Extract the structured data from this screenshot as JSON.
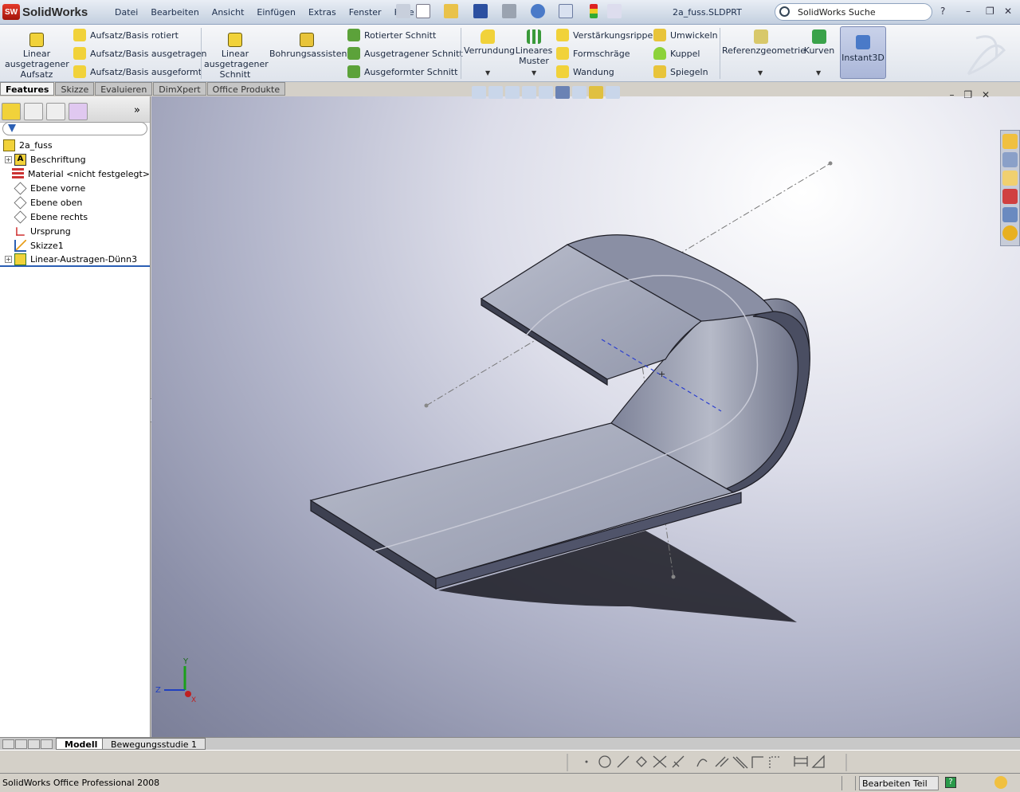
{
  "app": {
    "name": "SolidWorks",
    "logo_badge": "SW",
    "document_title": "2a_fuss.SLDPRT"
  },
  "menu": [
    "Datei",
    "Bearbeiten",
    "Ansicht",
    "Einfügen",
    "Extras",
    "Fenster",
    "Hilfe"
  ],
  "search": {
    "placeholder": "SolidWorks Suche"
  },
  "window_controls": {
    "help": "?",
    "minimize": "–",
    "restore": "❐",
    "close": "✕"
  },
  "command_manager": {
    "linear_boss": "Linear ausgetragener Aufsatz",
    "revolved_boss": "Aufsatz/Basis rotiert",
    "swept_boss": "Aufsatz/Basis ausgetragen",
    "lofted_boss": "Aufsatz/Basis ausgeformt",
    "extruded_cut": "Linear ausgetragener Schnitt",
    "hole_wizard": "Bohrungsassistent",
    "revolved_cut": "Rotierter Schnitt",
    "swept_cut": "Ausgetragener Schnitt",
    "lofted_cut": "Ausgeformter Schnitt",
    "fillet": "Verrundung",
    "linear_pattern": "Lineares Muster",
    "rib": "Verstärkungsrippe",
    "draft": "Formschräge",
    "shell": "Wandung",
    "wrap": "Umwickeln",
    "dome": "Kuppel",
    "mirror": "Spiegeln",
    "ref_geometry": "Referenzgeometrie",
    "curves": "Kurven",
    "instant3d": "Instant3D"
  },
  "tabs": [
    {
      "label": "Features",
      "active": true
    },
    {
      "label": "Skizze",
      "active": false
    },
    {
      "label": "Evaluieren",
      "active": false
    },
    {
      "label": "DimXpert",
      "active": false
    },
    {
      "label": "Office Produkte",
      "active": false
    }
  ],
  "tree": {
    "root": "2a_fuss",
    "items": [
      {
        "label": "Beschriftung",
        "expandable": true
      },
      {
        "label": "Material <nicht festgelegt>",
        "expandable": false
      },
      {
        "label": "Ebene vorne",
        "expandable": false
      },
      {
        "label": "Ebene oben",
        "expandable": false
      },
      {
        "label": "Ebene rechts",
        "expandable": false
      },
      {
        "label": "Ursprung",
        "expandable": false
      },
      {
        "label": "Skizze1",
        "expandable": false
      },
      {
        "label": "Linear-Austragen-Dünn3",
        "expandable": true
      }
    ]
  },
  "triad": {
    "x": "X",
    "y": "Y",
    "z": "Z"
  },
  "bottom_tabs": [
    "Modell",
    "Bewegungsstudie 1"
  ],
  "status": {
    "left": "SolidWorks Office Professional 2008",
    "mode": "Bearbeiten Teil"
  },
  "colors": {
    "part_face": "#9a9fb3",
    "part_top": "#b9bdcc",
    "part_edge": "#1e1e26",
    "accent": "#2b5fb4"
  }
}
